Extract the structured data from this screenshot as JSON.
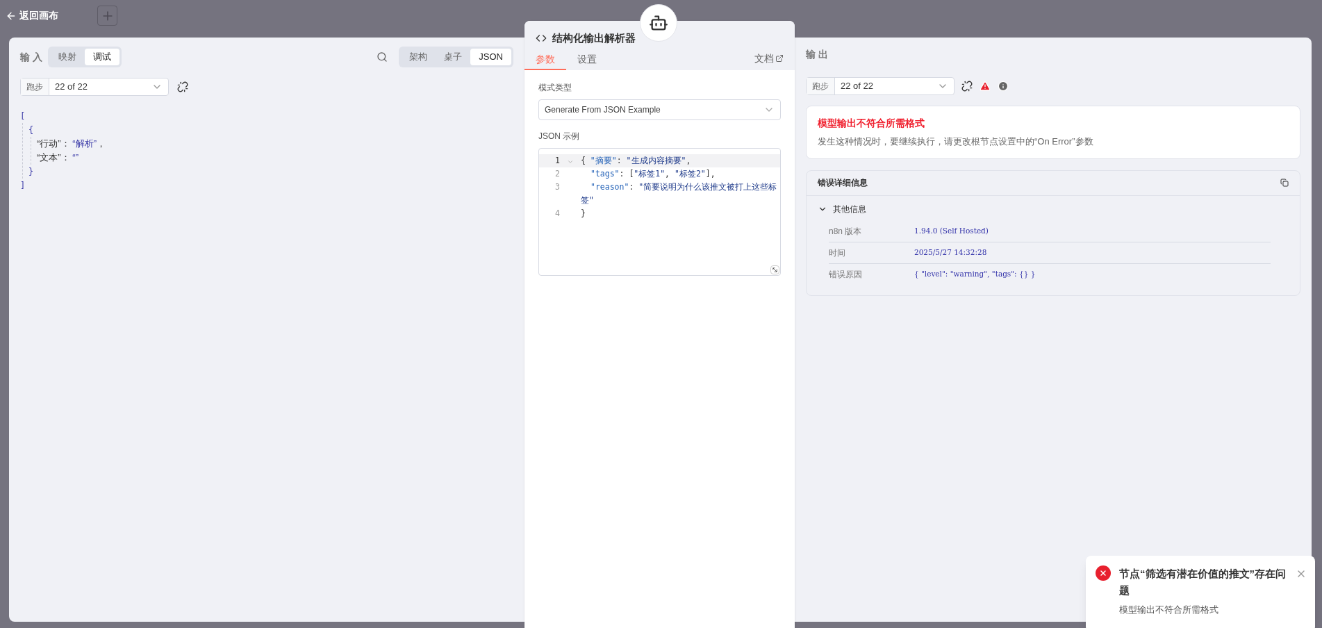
{
  "back_link": "返回画布",
  "input_panel": {
    "title": "输 入",
    "mode_tabs": [
      {
        "label": "映射",
        "selected": false
      },
      {
        "label": "调试",
        "selected": true
      }
    ],
    "view_tabs": [
      {
        "label": "架构",
        "selected": false
      },
      {
        "label": "桌子",
        "selected": false
      },
      {
        "label": "JSON",
        "selected": true
      }
    ],
    "run_label": "跑步",
    "run_value": "22 of 22",
    "json_view": {
      "open": "[",
      "close": "]",
      "children": [
        {
          "open": "{",
          "close": "}",
          "fields": [
            {
              "key": "“行动”",
              "separator": "：",
              "value": "“解析”",
              "comma": "，"
            },
            {
              "key": "“文本”",
              "separator": "：",
              "value": "“”"
            }
          ]
        }
      ]
    }
  },
  "node_panel": {
    "title": "结构化输出解析器",
    "tabs": [
      {
        "label": "参数",
        "selected": true
      },
      {
        "label": "设置",
        "selected": false
      }
    ],
    "docs_link": "文档",
    "schema_type": {
      "label": "模式类型",
      "value": "Generate From JSON Example"
    },
    "json_example": {
      "label": "JSON 示例",
      "lines": [
        {
          "number": "1",
          "foldable": true,
          "highlighted": true,
          "indented": false,
          "tokens": [
            {
              "kind": "punct",
              "text": "{ "
            },
            {
              "kind": "key",
              "text": "\"摘要\""
            },
            {
              "kind": "punct",
              "text": ": "
            },
            {
              "kind": "string",
              "text": "\"生成内容摘要\""
            },
            {
              "kind": "punct",
              "text": ","
            }
          ]
        },
        {
          "number": "2",
          "foldable": false,
          "highlighted": false,
          "indented": true,
          "tokens": [
            {
              "kind": "key",
              "text": "\"tags\""
            },
            {
              "kind": "punct",
              "text": ": ["
            },
            {
              "kind": "string",
              "text": "\"标签1\""
            },
            {
              "kind": "punct",
              "text": ", "
            },
            {
              "kind": "string",
              "text": "\"标签2\""
            },
            {
              "kind": "punct",
              "text": "],"
            }
          ]
        },
        {
          "number": "3",
          "foldable": false,
          "highlighted": false,
          "indented": true,
          "tokens": [
            {
              "kind": "key",
              "text": "\"reason\""
            },
            {
              "kind": "punct",
              "text": ": "
            },
            {
              "kind": "string",
              "text": "\"简要说明为什么该推文被打上这些标签\""
            }
          ]
        },
        {
          "number": "4",
          "foldable": false,
          "highlighted": false,
          "indented": false,
          "tokens": [
            {
              "kind": "punct",
              "text": "}"
            }
          ]
        }
      ]
    }
  },
  "output_panel": {
    "title": "输 出",
    "run_label": "跑步",
    "run_value": "22 of 22",
    "error": {
      "title": "模型输出不符合所需格式",
      "message": "发生这种情况时，要继续执行，请更改根节点设置中的“On Error”参数"
    },
    "details": {
      "title": "错误详细信息",
      "section": {
        "title": "其他信息",
        "expanded": true,
        "rows": [
          {
            "label": "n8n 版本",
            "value": "1.94.0 (Self Hosted)"
          },
          {
            "label": "时间",
            "value": "2025/5/27 14:32:28"
          },
          {
            "label": "错误原因",
            "value": "{ \"level\": \"warning\", \"tags\": {} }"
          }
        ]
      }
    }
  },
  "toast": {
    "title": "节点“筛选有潜在价值的推文”存在问题",
    "message": "模型输出不符合所需格式"
  }
}
